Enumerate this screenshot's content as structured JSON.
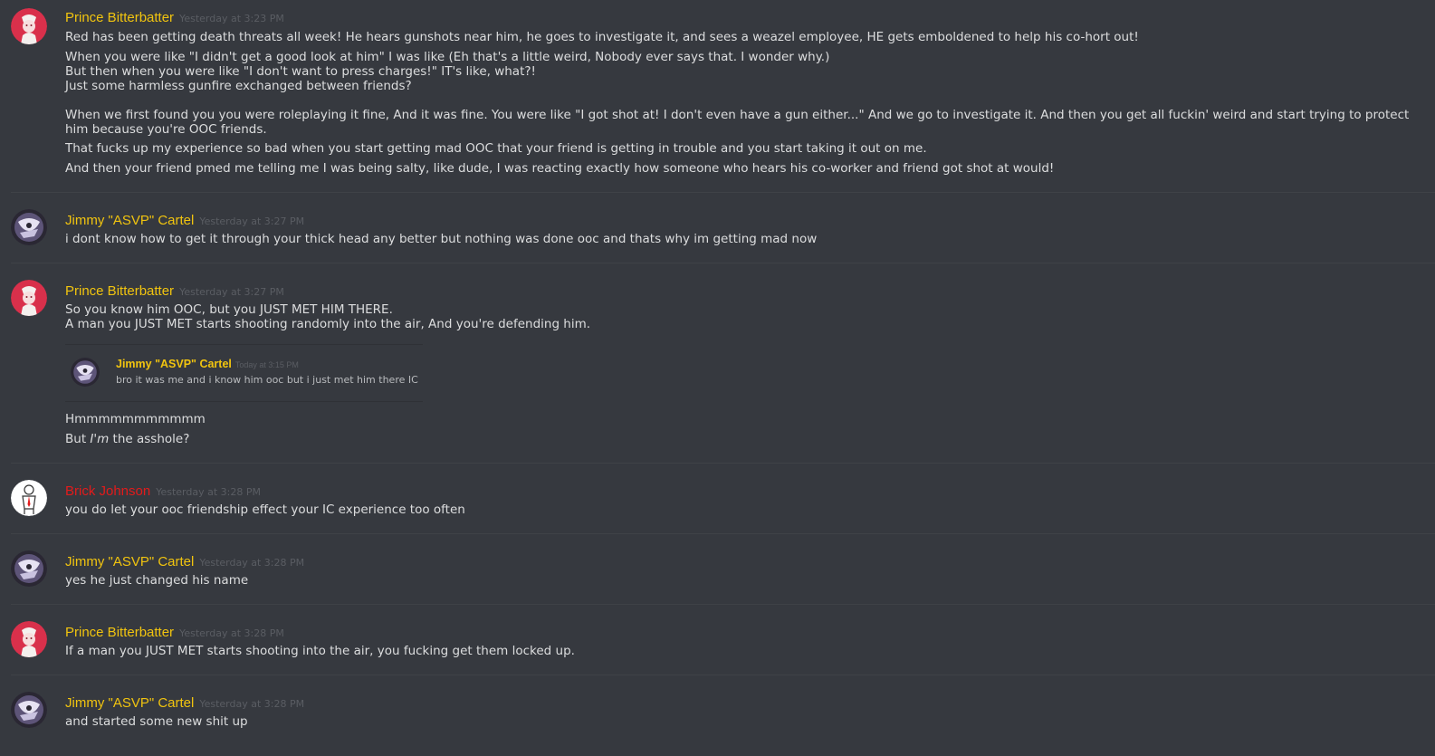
{
  "colors": {
    "background": "#36393f",
    "username_gold": "#f1c40f",
    "username_red": "#e31b1b",
    "timestamp": "#5a5d63",
    "text": "#dcddde",
    "prince_avatar": "#d9304b",
    "jimmy_avatar": "#2a2733",
    "brick_avatar": "#ffffff"
  },
  "messages": [
    {
      "author": "Prince Bitterbatter",
      "avatar": "prince-avatar",
      "timestamp": "Yesterday at 3:23 PM",
      "lines": [
        "Red has been getting death threats all week! He hears gunshots near him, he goes to investigate it, and sees a weazel employee, HE gets emboldened to help his co-hort out!",
        "When you were like \"I didn't get a good look at him\" I was like (Eh that's a little weird, Nobody ever says that. I wonder why.)",
        "But then when you were like \"I don't want to press charges!\" IT's like, what?!",
        "Just some harmless gunfire exchanged between friends?",
        "When we first found you you were roleplaying it fine, And it was fine. You were like \"I got shot at! I don't even have a gun either...\" And we go to investigate it. And then you get all fuckin' weird and start trying to protect him because you're OOC friends.",
        "That fucks up my experience so bad when you start getting mad OOC that your friend is getting in trouble and you start taking it out on me.",
        "And then your friend pmed me telling me I was being salty, like dude, I was reacting exactly how someone who hears his co-worker and friend got shot at would!"
      ]
    },
    {
      "author": "Jimmy \"ASVP\" Cartel",
      "avatar": "jimmy-avatar",
      "timestamp": "Yesterday at 3:27 PM",
      "lines": [
        "i dont know how to get it through your thick head any better but nothing was done ooc and thats why im getting mad now"
      ]
    },
    {
      "author": "Prince Bitterbatter",
      "avatar": "prince-avatar",
      "timestamp": "Yesterday at 3:27 PM",
      "lines": [
        "So you know him OOC, but you JUST MET HIM THERE.",
        "A man you JUST MET starts shooting randomly into the air, And you're defending him.",
        "Hmmmmmmmmmmm",
        "But ",
        "I'm",
        " the asshole?"
      ],
      "embed": {
        "author": "Jimmy \"ASVP\" Cartel",
        "timestamp": "Today at 3:15 PM",
        "text": "bro it was me and i know him ooc but i just met him there IC"
      }
    },
    {
      "author": "Brick Johnson",
      "avatar": "brick-avatar",
      "timestamp": "Yesterday at 3:28 PM",
      "lines": [
        "you do let your ooc friendship effect your IC experience too often"
      ]
    },
    {
      "author": "Jimmy \"ASVP\" Cartel",
      "avatar": "jimmy-avatar",
      "timestamp": "Yesterday at 3:28 PM",
      "lines": [
        "yes he just changed his name"
      ]
    },
    {
      "author": "Prince Bitterbatter",
      "avatar": "prince-avatar",
      "timestamp": "Yesterday at 3:28 PM",
      "lines": [
        "If a man you JUST MET starts shooting into the air, you fucking get them locked up."
      ]
    },
    {
      "author": "Jimmy \"ASVP\" Cartel",
      "avatar": "jimmy-avatar",
      "timestamp": "Yesterday at 3:28 PM",
      "lines": [
        "and started some new shit up"
      ]
    }
  ]
}
